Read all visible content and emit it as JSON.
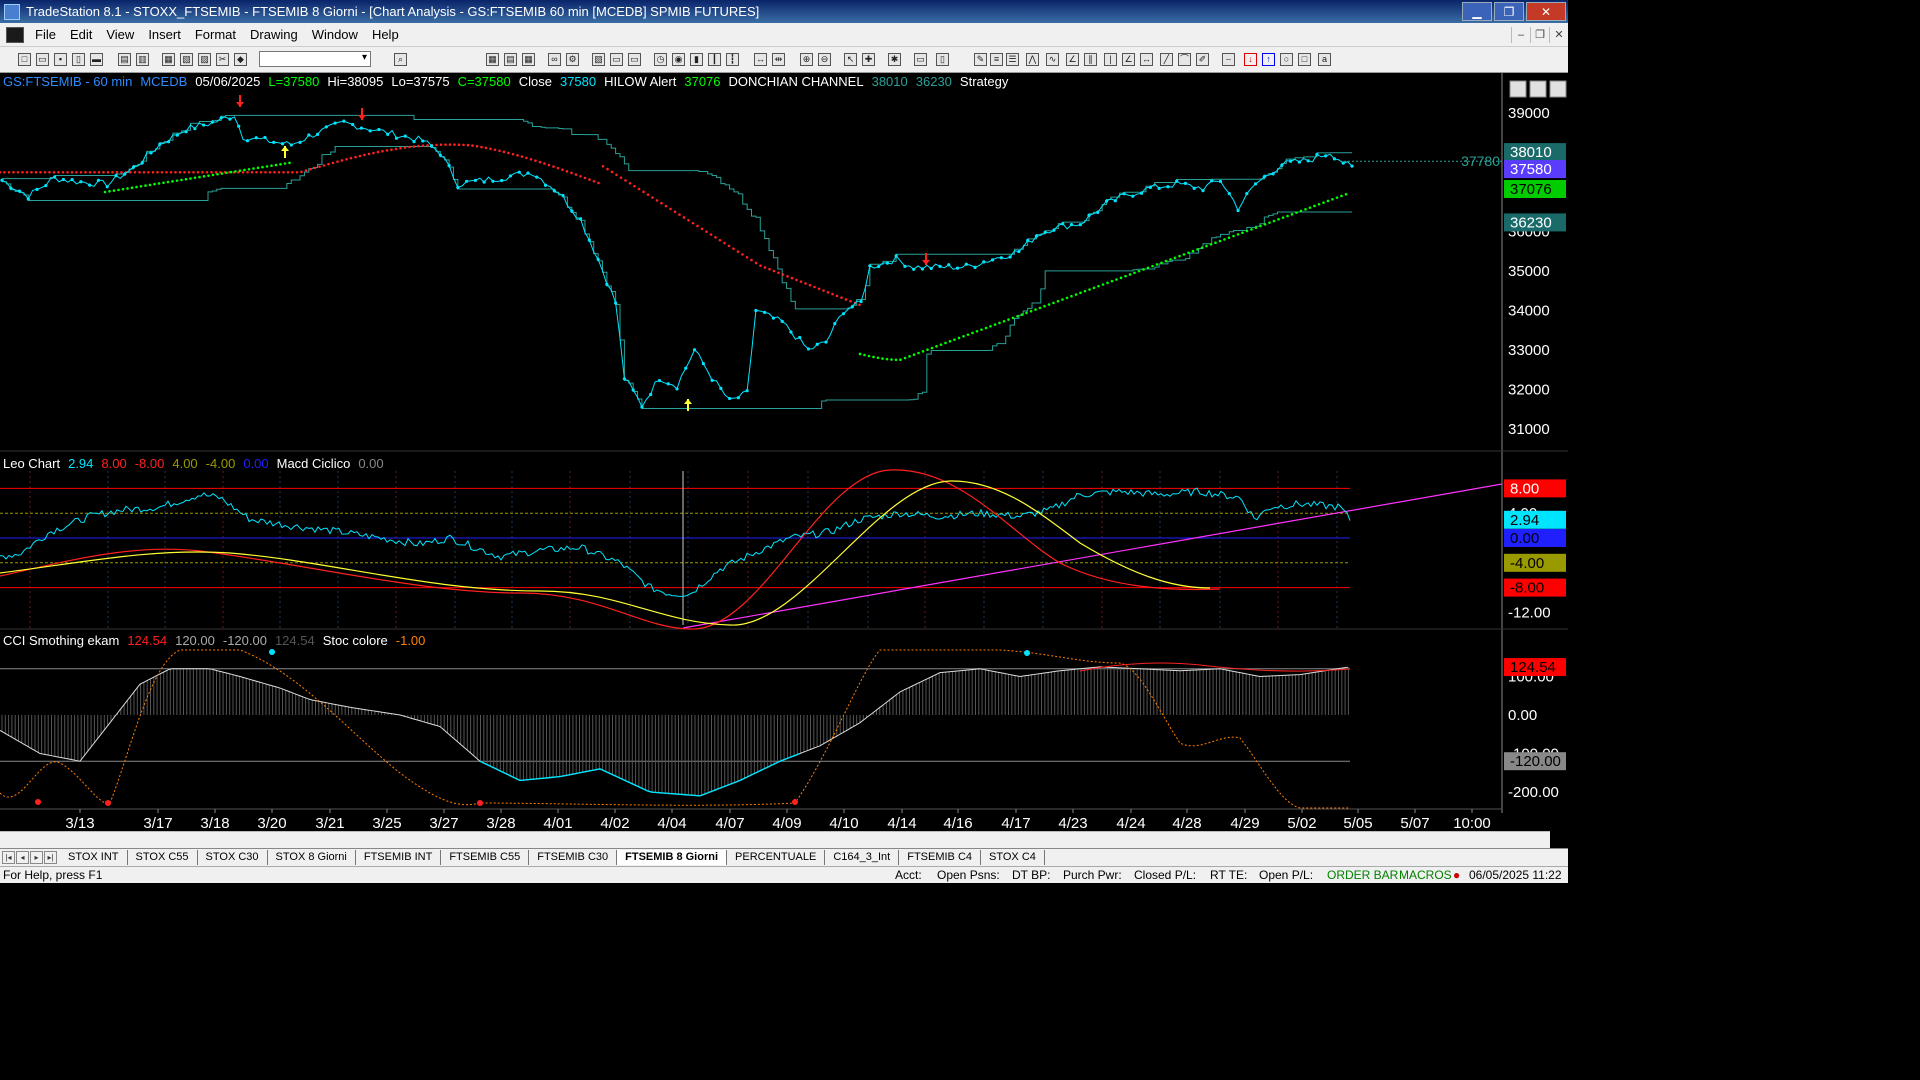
{
  "window": {
    "title": "TradeStation 8.1 - STOXX_FTSEMIB - FTSEMIB  8 Giorni - [Chart Analysis - GS:FTSEMIB  60 min  [MCEDB] SPMIB FUTURES]",
    "minimize": "▁",
    "restore": "❐",
    "close": "✕"
  },
  "menu": [
    "File",
    "Edit",
    "View",
    "Insert",
    "Format",
    "Drawing",
    "Window",
    "Help"
  ],
  "header1": [
    {
      "text": "GS:FTSEMIB - 60 min",
      "color": "#2f8bff"
    },
    {
      "text": "MCEDB",
      "color": "#2f8bff"
    },
    {
      "text": "05/06/2025",
      "color": "#ffffff"
    },
    {
      "text": "L=37580",
      "color": "#00ff00"
    },
    {
      "text": "Hi=38095",
      "color": "#ffffff"
    },
    {
      "text": "Lo=37575",
      "color": "#ffffff"
    },
    {
      "text": "C=37580",
      "color": "#00ff00"
    },
    {
      "text": "Close",
      "color": "#ffffff"
    },
    {
      "text": "37580",
      "color": "#00e5ff"
    },
    {
      "text": "HILOW Alert",
      "color": "#ffffff"
    },
    {
      "text": "37076",
      "color": "#00ff00"
    },
    {
      "text": "DONCHIAN CHANNEL",
      "color": "#ffffff"
    },
    {
      "text": "38010",
      "color": "#2aa198"
    },
    {
      "text": "36230",
      "color": "#2aa198"
    },
    {
      "text": "Strategy",
      "color": "#ffffff"
    }
  ],
  "header2": [
    {
      "text": "Leo Chart",
      "color": "#ffffff"
    },
    {
      "text": "2.94",
      "color": "#00e5ff"
    },
    {
      "text": "8.00",
      "color": "#ff2020"
    },
    {
      "text": "-8.00",
      "color": "#ff2020"
    },
    {
      "text": "4.00",
      "color": "#999900"
    },
    {
      "text": "-4.00",
      "color": "#999900"
    },
    {
      "text": "0.00",
      "color": "#2020ff"
    },
    {
      "text": "Macd Ciclico",
      "color": "#ffffff"
    },
    {
      "text": "0.00",
      "color": "#888888"
    }
  ],
  "header3": [
    {
      "text": "CCI Smothing ekam",
      "color": "#ffffff"
    },
    {
      "text": "124.54",
      "color": "#ff2020"
    },
    {
      "text": "120.00",
      "color": "#aaaaaa"
    },
    {
      "text": "-120.00",
      "color": "#aaaaaa"
    },
    {
      "text": "124.54",
      "color": "#555555"
    },
    {
      "text": "Stoc colore",
      "color": "#ffffff"
    },
    {
      "text": "-1.00",
      "color": "#ff8000"
    }
  ],
  "price_axis": [
    "39000",
    "38000",
    "37000",
    "36000",
    "35000",
    "34000",
    "33000",
    "32000",
    "31000"
  ],
  "price_tags": [
    {
      "label": "38010",
      "bg": "#1a6a6a",
      "fg": "#ffffff",
      "value": 38010
    },
    {
      "label": "37580",
      "bg": "#5a3cff",
      "fg": "#ffffff",
      "value": 37580
    },
    {
      "label": "37076",
      "bg": "#00cc00",
      "fg": "#000000",
      "value": 37076
    },
    {
      "label": "36230",
      "bg": "#1a6a6a",
      "fg": "#ffffff",
      "value": 36230
    }
  ],
  "price_left_label": "37780",
  "leo_axis": [
    "8.00",
    "4.00",
    "0.00",
    "-4.00",
    "-8.00",
    "-12.00"
  ],
  "leo_tags": [
    {
      "label": "8.00",
      "bg": "#ff0000",
      "fg": "#ffffff",
      "value": 8
    },
    {
      "label": "2.94",
      "bg": "#00e5ff",
      "fg": "#000000",
      "value": 2.94
    },
    {
      "label": "0.00",
      "bg": "#2020ff",
      "fg": "#000000",
      "value": 0
    },
    {
      "label": "-4.00",
      "bg": "#999900",
      "fg": "#000000",
      "value": -4
    },
    {
      "label": "-8.00",
      "bg": "#ff0000",
      "fg": "#000000",
      "value": -8
    }
  ],
  "cci_axis": [
    "100.00",
    "0.00",
    "-100.00",
    "-200.00"
  ],
  "cci_tags": [
    {
      "label": "124.54",
      "bg": "#ff0000",
      "fg": "#000000",
      "value": 124.54
    },
    {
      "label": "-120.00",
      "bg": "#888888",
      "fg": "#000000",
      "value": -120
    }
  ],
  "date_labels": [
    "3/13",
    "3/17",
    "3/18",
    "3/20",
    "3/21",
    "3/25",
    "3/27",
    "3/28",
    "4/01",
    "4/02",
    "4/04",
    "4/07",
    "4/09",
    "4/10",
    "4/14",
    "4/16",
    "4/17",
    "4/23",
    "4/24",
    "4/28",
    "4/29",
    "5/02",
    "5/05",
    "5/07",
    "10:00"
  ],
  "tabs": [
    "STOX INT",
    "STOX C55",
    "STOX  C30",
    "STOX  8 Giorni",
    "FTSEMIB INT",
    "FTSEMIB C55",
    "FTSEMIB C30",
    "FTSEMIB  8 Giorni",
    "PERCENTUALE",
    "C164_3_Int",
    "FTSEMIB C4",
    "STOX  C4"
  ],
  "active_tab": 7,
  "status": {
    "help": "For Help, press F1",
    "acct": "Acct:",
    "open_psns": "Open Psns:",
    "dt_bp": "DT BP:",
    "purch_pwr": "Purch Pwr:",
    "closed_pl": "Closed P/L:",
    "rt_te": "RT TE:",
    "open_pl": "Open P/L:",
    "order_bar": "ORDER BAR",
    "macros": "MACROS",
    "datetime": "06/05/2025 11:22"
  },
  "colors": {
    "price": "#00e5ff",
    "donchian": "#2aa198",
    "red_dots": "#ff2020",
    "green_dots": "#00ff00",
    "leo": "#00e5ff",
    "macd_red": "#ff2020",
    "macd_yellow": "#ffff33",
    "trend": "#ff33ff",
    "cci": "#cccccc",
    "stoc": "#ff7f00"
  },
  "chart_data": {
    "type": "line",
    "price_keypoints": [
      [
        0,
        37300
      ],
      [
        6,
        36900
      ],
      [
        12,
        37350
      ],
      [
        18,
        37250
      ],
      [
        24,
        37200
      ],
      [
        30,
        37600
      ],
      [
        36,
        38200
      ],
      [
        42,
        38600
      ],
      [
        48,
        38750
      ],
      [
        53,
        38950
      ],
      [
        55,
        38400
      ],
      [
        60,
        38300
      ],
      [
        66,
        38200
      ],
      [
        72,
        38500
      ],
      [
        78,
        38750
      ],
      [
        84,
        38600
      ],
      [
        90,
        38450
      ],
      [
        96,
        38300
      ],
      [
        100,
        38000
      ],
      [
        104,
        37200
      ],
      [
        110,
        37300
      ],
      [
        116,
        37400
      ],
      [
        121,
        37500
      ],
      [
        127,
        37000
      ],
      [
        132,
        36300
      ],
      [
        136,
        35300
      ],
      [
        140,
        34200
      ],
      [
        142,
        32300
      ],
      [
        146,
        31600
      ],
      [
        150,
        32300
      ],
      [
        154,
        32100
      ],
      [
        158,
        33000
      ],
      [
        162,
        32300
      ],
      [
        166,
        31700
      ],
      [
        170,
        31900
      ],
      [
        172,
        34000
      ],
      [
        178,
        33700
      ],
      [
        184,
        33000
      ],
      [
        188,
        33200
      ],
      [
        192,
        34000
      ],
      [
        196,
        34200
      ],
      [
        198,
        35100
      ],
      [
        204,
        35300
      ],
      [
        208,
        35100
      ],
      [
        214,
        35100
      ],
      [
        220,
        35100
      ],
      [
        226,
        35300
      ],
      [
        232,
        35500
      ],
      [
        236,
        35900
      ],
      [
        240,
        36100
      ],
      [
        246,
        36200
      ],
      [
        252,
        36700
      ],
      [
        256,
        36900
      ],
      [
        262,
        37100
      ],
      [
        268,
        37200
      ],
      [
        274,
        37100
      ],
      [
        278,
        37300
      ],
      [
        282,
        36600
      ],
      [
        286,
        37200
      ],
      [
        292,
        37700
      ],
      [
        298,
        37800
      ],
      [
        303,
        38000
      ],
      [
        308,
        37600
      ]
    ]
  }
}
